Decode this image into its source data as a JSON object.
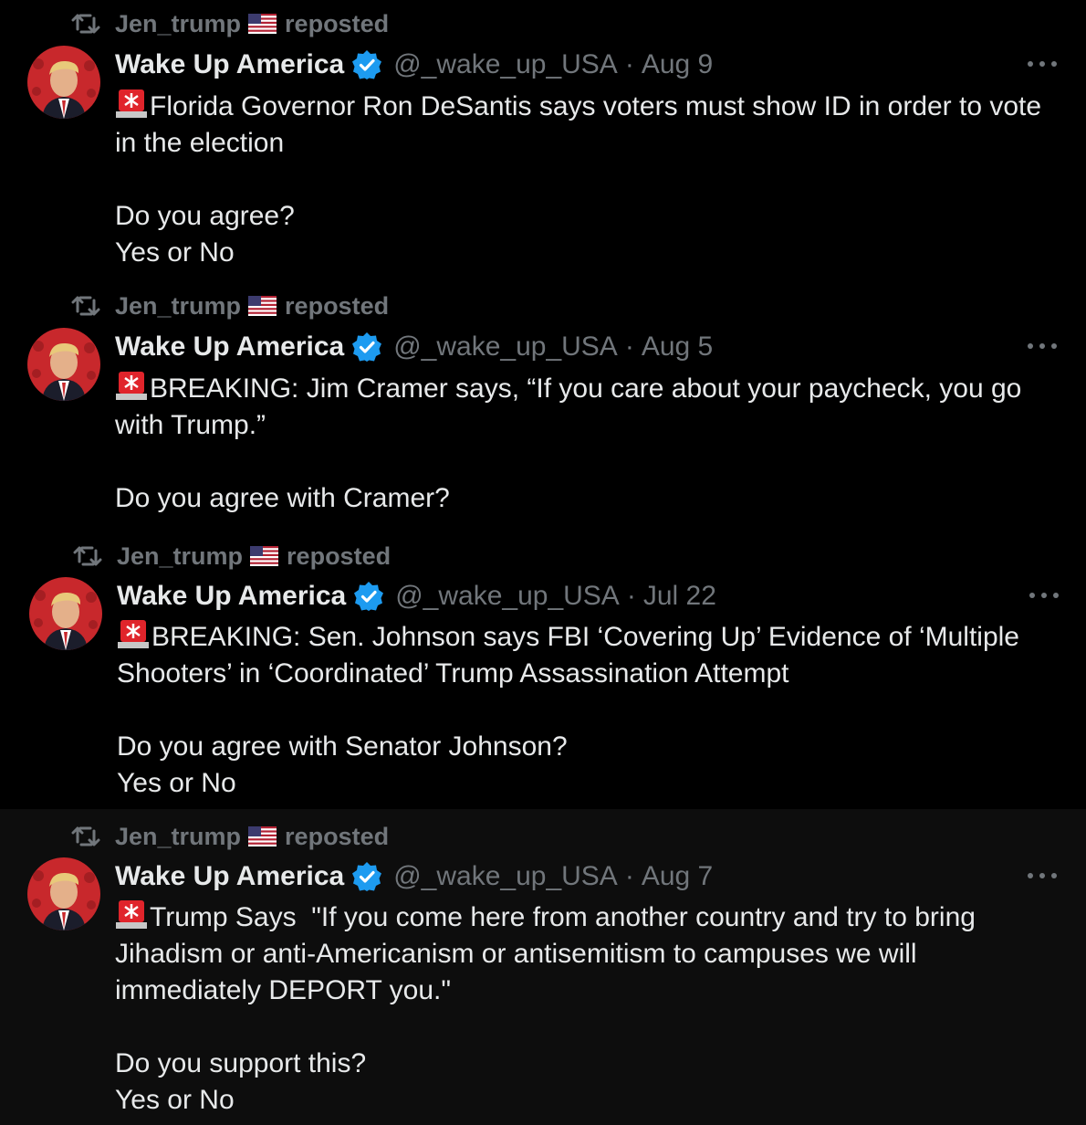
{
  "repost": {
    "user": "Jen_trump",
    "label": "reposted"
  },
  "author": {
    "display_name": "Wake Up America",
    "handle": "@_wake_up_USA",
    "separator": "·"
  },
  "colors": {
    "background": "#000000",
    "text": "#e7e9ea",
    "muted": "#71767b",
    "verified": "#1d9bf0",
    "alarm": "#e0242b"
  },
  "icons": {
    "repost": "repost-icon",
    "flag": "us-flag-icon",
    "verified": "verified-badge-icon",
    "alarm": "police-light-icon",
    "more": "more-icon"
  },
  "posts": [
    {
      "date": "Aug 9",
      "text": "Florida Governor Ron DeSantis says voters must show ID in order to vote in the election\n\nDo you agree?\nYes or No"
    },
    {
      "date": "Aug 5",
      "text": "BREAKING: Jim Cramer says, “If you care about your paycheck, you go with Trump.”\n\nDo you agree with Cramer?"
    },
    {
      "date": "Jul 22",
      "text": "BREAKING: Sen. Johnson says FBI ‘Covering Up’ Evidence of ‘Multiple Shooters’ in ‘Coordinated’ Trump Assassination Attempt\n\nDo you agree with Senator Johnson?\nYes or No"
    },
    {
      "date": "Aug 7",
      "text": "Trump Says  \"If you come here from another country and try to bring Jihadism or anti-Americanism or antisemitism to campuses we will immediately DEPORT you.\"\n\nDo you support this?\nYes or No"
    }
  ]
}
